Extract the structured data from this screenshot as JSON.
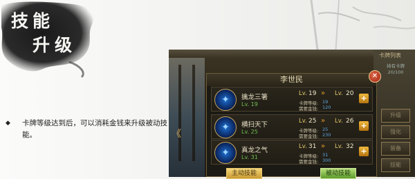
{
  "title": {
    "c1": "技",
    "c2": "能",
    "c3": "升",
    "c4": "级"
  },
  "description": {
    "bullet": "◆",
    "text": "卡牌等级达到后，可以消耗金钱来升级被动技能。"
  },
  "card_list": {
    "title": "卡牌列表",
    "owned_label": "持有卡牌",
    "owned_count": "20/100",
    "side_buttons": [
      "升级",
      "强化",
      "装备",
      "技能"
    ]
  },
  "modal": {
    "title": "李世民",
    "close": "✕",
    "rows": [
      {
        "name": "擒龙三箸",
        "lv": "Lv. 19",
        "cur_lbl": "Lv.",
        "cur": "19",
        "next_lbl": "Lv.",
        "next": "20",
        "req_lv_lbl": "卡牌等级:",
        "req_lv": "19",
        "req_gold_lbl": "需要金钱:",
        "req_gold": "120"
      },
      {
        "name": "横扫天下",
        "lv": "Lv. 25",
        "cur_lbl": "Lv.",
        "cur": "25",
        "next_lbl": "Lv.",
        "next": "26",
        "req_lv_lbl": "卡牌等级:",
        "req_lv": "25",
        "req_gold_lbl": "需要金钱:",
        "req_gold": "230"
      },
      {
        "name": "真龙之气",
        "lv": "Lv. 31",
        "cur_lbl": "Lv.",
        "cur": "31",
        "next_lbl": "Lv.",
        "next": "32",
        "req_lv_lbl": "卡牌等级:",
        "req_lv": "31",
        "req_gold_lbl": "需要金钱:",
        "req_gold": "300"
      }
    ],
    "tab_active": "主动技能",
    "tab_passive": "被动技能"
  },
  "icons": {
    "plus": "+",
    "arrow": "»",
    "left": "《"
  }
}
